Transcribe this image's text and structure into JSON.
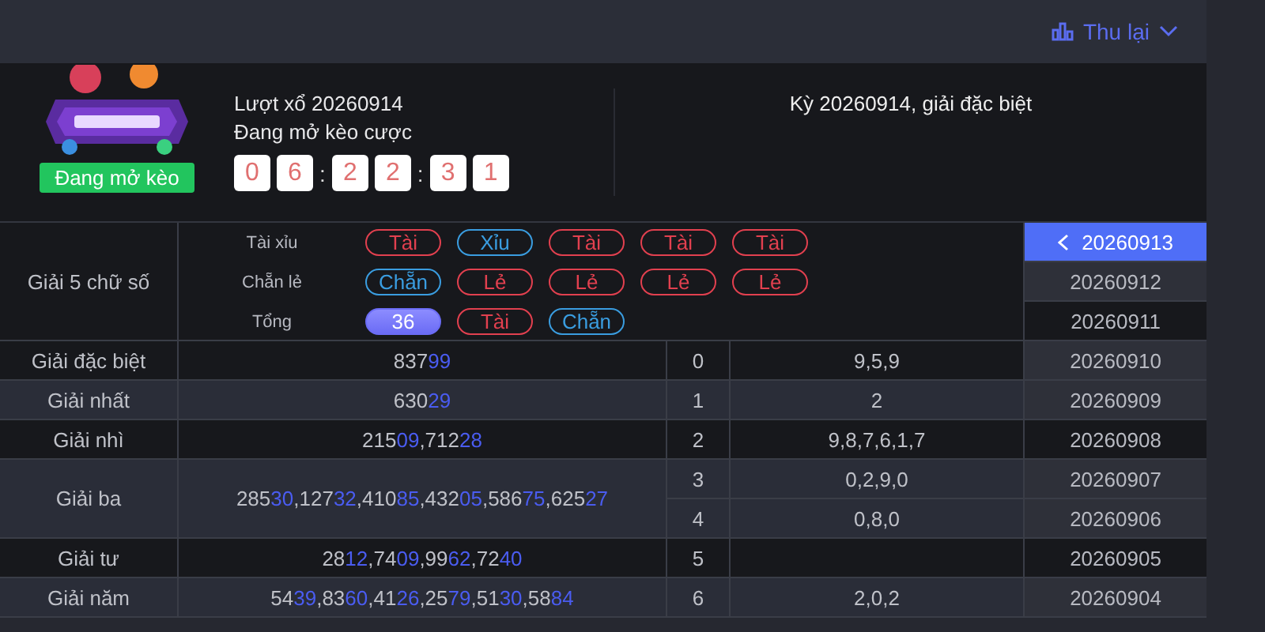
{
  "top_bar": {
    "collapse_label": "Thu lại"
  },
  "draw": {
    "status_badge": "Đang mở kèo",
    "round": "Lượt xổ 20260914",
    "state": "Đang mở kèo cược",
    "countdown": [
      "0",
      "6",
      ":",
      "2",
      "2",
      ":",
      "3",
      "1"
    ],
    "result_title": "Kỳ 20260914, giải đặc biệt"
  },
  "summary": {
    "label": "Giải 5 chữ số",
    "rows": [
      {
        "label": "Tài xỉu",
        "pills": [
          {
            "text": "Tài",
            "color": "#e2404f",
            "kind": "outline"
          },
          {
            "text": "Xỉu",
            "color": "#3a9de0",
            "kind": "outline"
          },
          {
            "text": "Tài",
            "color": "#e2404f",
            "kind": "outline"
          },
          {
            "text": "Tài",
            "color": "#e2404f",
            "kind": "outline"
          },
          {
            "text": "Tài",
            "color": "#e2404f",
            "kind": "outline"
          }
        ]
      },
      {
        "label": "Chẵn lẻ",
        "pills": [
          {
            "text": "Chẵn",
            "color": "#3a9de0",
            "kind": "outline"
          },
          {
            "text": "Lẻ",
            "color": "#e2404f",
            "kind": "outline"
          },
          {
            "text": "Lẻ",
            "color": "#e2404f",
            "kind": "outline"
          },
          {
            "text": "Lẻ",
            "color": "#e2404f",
            "kind": "outline"
          },
          {
            "text": "Lẻ",
            "color": "#e2404f",
            "kind": "outline"
          }
        ]
      },
      {
        "label": "Tổng",
        "pills": [
          {
            "text": "36",
            "color": "#6b6cf5",
            "kind": "filled"
          },
          {
            "text": "Tài",
            "color": "#e2404f",
            "kind": "outline"
          },
          {
            "text": "Chẵn",
            "color": "#3a9de0",
            "kind": "outline"
          }
        ]
      }
    ]
  },
  "prizes": [
    {
      "name": "Giải đặc biệt",
      "segments": [
        {
          "text": "837",
          "accent": false
        },
        {
          "text": "99",
          "accent": true
        }
      ],
      "heads": [
        {
          "index": "0",
          "digits": "9,5,9"
        }
      ]
    },
    {
      "name": "Giải nhất",
      "segments": [
        {
          "text": "630",
          "accent": false
        },
        {
          "text": "29",
          "accent": true
        }
      ],
      "heads": [
        {
          "index": "1",
          "digits": "2"
        }
      ]
    },
    {
      "name": "Giải nhì",
      "segments": [
        {
          "text": "215",
          "accent": false
        },
        {
          "text": "09",
          "accent": true
        },
        {
          "text": ",712",
          "accent": false
        },
        {
          "text": "28",
          "accent": true
        }
      ],
      "heads": [
        {
          "index": "2",
          "digits": "9,8,7,6,1,7"
        }
      ]
    },
    {
      "name": "Giải ba",
      "segments": [
        {
          "text": "285",
          "accent": false
        },
        {
          "text": "30",
          "accent": true
        },
        {
          "text": ",127",
          "accent": false
        },
        {
          "text": "32",
          "accent": true
        },
        {
          "text": ",410",
          "accent": false
        },
        {
          "text": "85",
          "accent": true
        },
        {
          "text": ",432",
          "accent": false
        },
        {
          "text": "05",
          "accent": true
        },
        {
          "text": ",586",
          "accent": false
        },
        {
          "text": "75",
          "accent": true
        },
        {
          "text": ",625",
          "accent": false
        },
        {
          "text": "27",
          "accent": true
        }
      ],
      "heads": [
        {
          "index": "3",
          "digits": "0,2,9,0"
        },
        {
          "index": "4",
          "digits": "0,8,0"
        }
      ]
    },
    {
      "name": "Giải tư",
      "segments": [
        {
          "text": "28",
          "accent": false
        },
        {
          "text": "12",
          "accent": true
        },
        {
          "text": ",74",
          "accent": false
        },
        {
          "text": "09",
          "accent": true
        },
        {
          "text": ",99",
          "accent": false
        },
        {
          "text": "62",
          "accent": true
        },
        {
          "text": ",72",
          "accent": false
        },
        {
          "text": "40",
          "accent": true
        }
      ],
      "heads": [
        {
          "index": "5"
        }
      ]
    },
    {
      "name": "Giải năm",
      "segments": [
        {
          "text": "54",
          "accent": false
        },
        {
          "text": "39",
          "accent": true
        },
        {
          "text": ",83",
          "accent": false
        },
        {
          "text": "60",
          "accent": true
        },
        {
          "text": ",41",
          "accent": false
        },
        {
          "text": "26",
          "accent": true
        },
        {
          "text": ",25",
          "accent": false
        },
        {
          "text": "79",
          "accent": true
        },
        {
          "text": ",51",
          "accent": false
        },
        {
          "text": "30",
          "accent": true
        },
        {
          "text": ",58",
          "accent": false
        },
        {
          "text": "84",
          "accent": true
        }
      ],
      "heads": [
        {
          "index": "6",
          "digits": "2,0,2"
        }
      ]
    }
  ],
  "periods": [
    {
      "label": "20260913",
      "selected": true
    },
    {
      "label": "20260912",
      "selected": false
    },
    {
      "label": "20260911",
      "selected": false
    },
    {
      "label": "20260910",
      "selected": false
    },
    {
      "label": "20260909",
      "selected": false
    },
    {
      "label": "20260908",
      "selected": false
    },
    {
      "label": "20260907",
      "selected": false
    },
    {
      "label": "20260906",
      "selected": false
    },
    {
      "label": "20260905",
      "selected": false
    },
    {
      "label": "20260904",
      "selected": false
    }
  ]
}
